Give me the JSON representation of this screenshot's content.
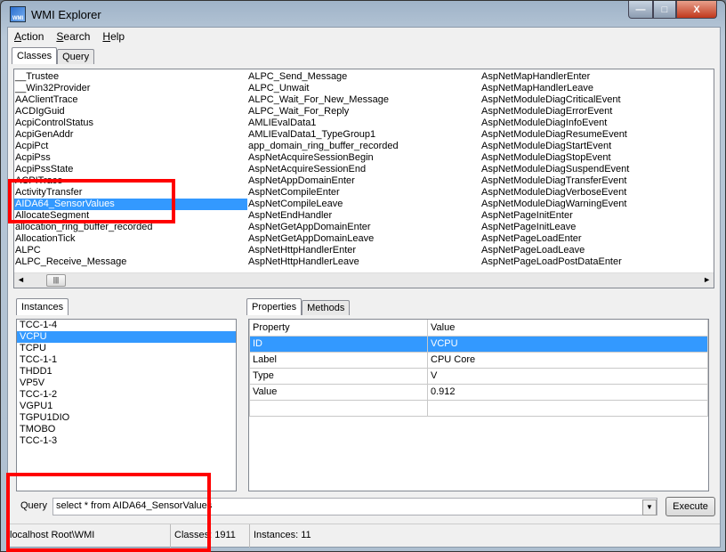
{
  "window": {
    "title": "WMI Explorer",
    "min_label": "—",
    "max_label": "□",
    "close_label": "X"
  },
  "menu": [
    {
      "label": "Action",
      "key": "A",
      "rest": "ction"
    },
    {
      "label": "Search",
      "key": "S",
      "rest": "earch"
    },
    {
      "label": "Help",
      "key": "H",
      "rest": "elp"
    }
  ],
  "top_tabs": [
    "Classes",
    "Query"
  ],
  "classes": {
    "col1": [
      "__Trustee",
      "__Win32Provider",
      "AAClientTrace",
      "ACDIgGuid",
      "AcpiControlStatus",
      "AcpiGenAddr",
      "AcpiPct",
      "AcpiPss",
      "AcpiPssState",
      "ACPITrace",
      "ActivityTransfer",
      "AIDA64_SensorValues",
      "AllocateSegment",
      "allocation_ring_buffer_recorded",
      "AllocationTick",
      "ALPC",
      "ALPC_Receive_Message"
    ],
    "col2": [
      "ALPC_Send_Message",
      "ALPC_Unwait",
      "ALPC_Wait_For_New_Message",
      "ALPC_Wait_For_Reply",
      "AMLIEvalData1",
      "AMLIEvalData1_TypeGroup1",
      "app_domain_ring_buffer_recorded",
      "AspNetAcquireSessionBegin",
      "AspNetAcquireSessionEnd",
      "AspNetAppDomainEnter",
      "AspNetCompileEnter",
      "AspNetCompileLeave",
      "AspNetEndHandler",
      "AspNetGetAppDomainEnter",
      "AspNetGetAppDomainLeave",
      "AspNetHttpHandlerEnter",
      "AspNetHttpHandlerLeave"
    ],
    "col3": [
      "AspNetMapHandlerEnter",
      "AspNetMapHandlerLeave",
      "AspNetModuleDiagCriticalEvent",
      "AspNetModuleDiagErrorEvent",
      "AspNetModuleDiagInfoEvent",
      "AspNetModuleDiagResumeEvent",
      "AspNetModuleDiagStartEvent",
      "AspNetModuleDiagStopEvent",
      "AspNetModuleDiagSuspendEvent",
      "AspNetModuleDiagTransferEvent",
      "AspNetModuleDiagVerboseEvent",
      "AspNetModuleDiagWarningEvent",
      "AspNetPageInitEnter",
      "AspNetPageInitLeave",
      "AspNetPageLoadEnter",
      "AspNetPageLoadLeave",
      "AspNetPageLoadPostDataEnter"
    ],
    "selected": "AIDA64_SensorValues"
  },
  "instances": {
    "tab": "Instances",
    "items": [
      "TCC-1-4",
      "VCPU",
      "TCPU",
      "TCC-1-1",
      "THDD1",
      "VP5V",
      "TCC-1-2",
      "VGPU1",
      "TGPU1DIO",
      "TMOBO",
      "TCC-1-3"
    ],
    "selected": "VCPU"
  },
  "props": {
    "tabs": [
      "Properties",
      "Methods"
    ],
    "headers": [
      "Property",
      "Value"
    ],
    "rows": [
      [
        "ID",
        "VCPU"
      ],
      [
        "Label",
        "CPU Core"
      ],
      [
        "Type",
        "V"
      ],
      [
        "Value",
        "0.912"
      ]
    ]
  },
  "query": {
    "label": "Query",
    "value": "select * from AIDA64_SensorValues",
    "execute": "Execute"
  },
  "status": {
    "connection": "localhost  Root\\WMI",
    "classes": "Classes: 1911",
    "instances": "Instances: 11"
  }
}
